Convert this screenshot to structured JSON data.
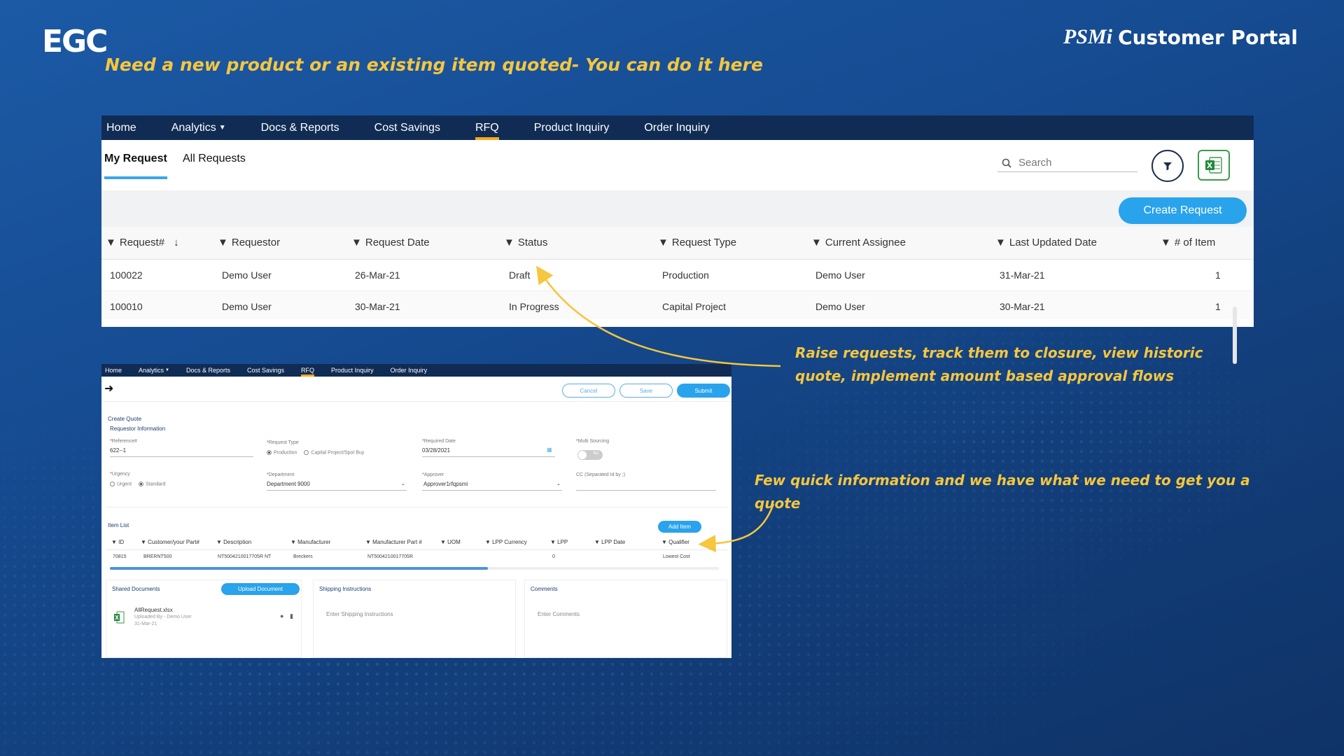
{
  "brand": {
    "left_logo": "EGC",
    "right_logo_mark": "PSMi",
    "right_logo_text": "Customer Portal"
  },
  "headline": "Need a new product or an existing item quoted- You can do it here",
  "callouts": {
    "first": "Raise requests, track them to closure, view historic quote, implement amount based approval flows",
    "second": "Few quick information and we have what we need to get you a quote"
  },
  "colors": {
    "background": "#154a8f",
    "nav": "#102c55",
    "accent": "#29a3ec",
    "highlight": "#f7c63c",
    "active_tab": "#f7a81b"
  },
  "nav": [
    "Home",
    "Analytics",
    "Docs & Reports",
    "Cost Savings",
    "RFQ",
    "Product Inquiry",
    "Order Inquiry"
  ],
  "list_view": {
    "tabs": {
      "my_request": "My Request",
      "all_requests": "All Requests"
    },
    "search_placeholder": "Search",
    "filter_icon": "filter-icon",
    "export_icon": "excel-icon",
    "create_button": "Create Request",
    "columns": [
      "Request#",
      "Requestor",
      "Request Date",
      "Status",
      "Request Type",
      "Current Assignee",
      "Last Updated Date",
      "# of Item"
    ],
    "sort_indicator": "↓",
    "rows": [
      [
        "100022",
        "Demo User",
        "26-Mar-21",
        "Draft",
        "Production",
        "Demo User",
        "31-Mar-21",
        "1"
      ],
      [
        "100010",
        "Demo User",
        "30-Mar-21",
        "In Progress",
        "Capital Project",
        "Demo User",
        "30-Mar-21",
        "1"
      ]
    ]
  },
  "quote_form": {
    "nav": [
      "Home",
      "Analytics",
      "Docs & Reports",
      "Cost Savings",
      "RFQ",
      "Product Inquiry",
      "Order Inquiry"
    ],
    "buttons": {
      "cancel": "Cancel",
      "save": "Save",
      "submit": "Submit"
    },
    "title": "Create Quote",
    "section": "Requestor Information",
    "reference_label": "Reference#",
    "reference_value": "622--1",
    "request_type_label": "Request Type",
    "request_type_options": [
      "Production",
      "Capital Project/Spot Buy"
    ],
    "required_date_label": "Required Date",
    "required_date_value": "03/28/2021",
    "multi_sourcing_label": "Multi Sourcing",
    "multi_sourcing_value": "No",
    "urgency_label": "Urgency",
    "urgency_options": [
      "Urgent",
      "Standard"
    ],
    "department_label": "Department",
    "department_value": "Department 9000",
    "approver_label": "Approver",
    "approver_value": "Approver1rfqpsmi",
    "cc_label": "CC (Separated Id by ;)",
    "item_list_title": "Item List",
    "add_item": "Add Item",
    "item_columns": [
      "ID",
      "Customer/your Part#",
      "Description",
      "Manufacturer",
      "Manufacturer Part #",
      "UOM",
      "LPP Currency",
      "LPP",
      "LPP Date",
      "Qualifier"
    ],
    "item_row": [
      "70815",
      "BRERNT500",
      "NT5004210017705R NT",
      "Breckers",
      "NT5004210017705R",
      "",
      "",
      "0",
      "",
      "Lowest Cost"
    ],
    "shared_docs_title": "Shared Documents",
    "upload_button": "Upload Document",
    "doc_name": "AllRequest.xlsx",
    "doc_uploaded_by": "Uploaded By - Demo User",
    "doc_date": "31-Mar-21",
    "shipping_title": "Shipping Instructions",
    "shipping_placeholder": "Enter Shipping Instructions",
    "comments_title": "Comments",
    "comments_placeholder": "Enter Comments"
  }
}
